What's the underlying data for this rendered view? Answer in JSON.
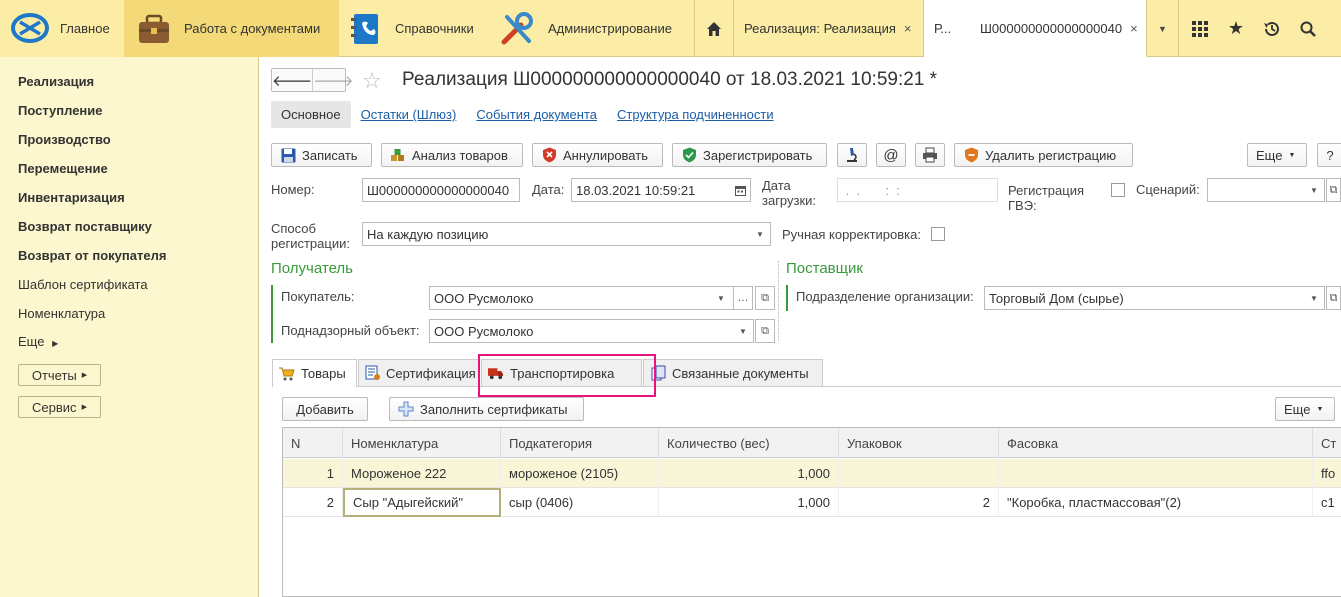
{
  "topbar": {
    "sections": [
      {
        "label": "Главное"
      },
      {
        "label": "Работа с документами"
      },
      {
        "label": "Справочники"
      },
      {
        "label": "Администрирование"
      }
    ],
    "open_tabs": [
      {
        "label": "Реализация: Реализация",
        "close": "×"
      },
      {
        "label_short": "Р...",
        "label": "Ш000000000000000040",
        "close": "×"
      }
    ]
  },
  "sidebar": {
    "items": [
      {
        "label": "Реализация"
      },
      {
        "label": "Поступление"
      },
      {
        "label": "Производство"
      },
      {
        "label": "Перемещение"
      },
      {
        "label": "Инвентаризация"
      },
      {
        "label": "Возврат поставщику"
      },
      {
        "label": "Возврат от покупателя"
      },
      {
        "label": "Шаблон сертификата"
      },
      {
        "label": "Номенклатура"
      }
    ],
    "more_label": "Еще",
    "reports_label": "Отчеты",
    "service_label": "Сервис"
  },
  "document": {
    "title": "Реализация Ш000000000000000040 от 18.03.2021 10:59:21 *",
    "section_tabs": [
      "Основное",
      "Остатки (Шлюз)",
      "События документа",
      "Структура подчиненности"
    ],
    "buttons": {
      "save": "Записать",
      "analyze": "Анализ товаров",
      "cancel": "Аннулировать",
      "register": "Зарегистрировать",
      "email": "@",
      "delete_reg": "Удалить регистрацию",
      "more": "Еще",
      "help": "?"
    },
    "fields": {
      "number_label": "Номер:",
      "number_value": "Ш000000000000000040",
      "date_label": "Дата:",
      "date_value": "18.03.2021 10:59:21",
      "load_date_label_1": "Дата",
      "load_date_label_2": "загрузки:",
      "load_date_value": " .  .       :  :",
      "gve_label_1": "Регистрация",
      "gve_label_2": "ГВЭ:",
      "scenario_label": "Сценарий:",
      "scenario_value": "",
      "reg_method_label_1": "Способ",
      "reg_method_label_2": "регистрации:",
      "reg_method_value": "На каждую позицию",
      "manual_corr_label": "Ручная корректировка:"
    },
    "recipient": {
      "title": "Получатель",
      "buyer_label": "Покупатель:",
      "buyer_value": "ООО Русмолоко",
      "object_label": "Поднадзорный объект:",
      "object_value": "ООО Русмолоко"
    },
    "supplier": {
      "title": "Поставщик",
      "dept_label": "Подразделение организации:",
      "dept_value": "Торговый Дом (сырье)"
    },
    "page_tabs": [
      "Товары",
      "Сертификация",
      "Транспортировка",
      "Связанные документы"
    ],
    "goods": {
      "add_label": "Добавить",
      "fill_cert_label": "Заполнить сертификаты",
      "more_label": "Еще",
      "columns": [
        "N",
        "Номенклатура",
        "Подкатегория",
        "Количество (вес)",
        "Упаковок",
        "Фасовка",
        "Ст"
      ],
      "rows": [
        {
          "n": "1",
          "nom": "Мороженое 222",
          "sub": "мороженое (2105)",
          "qty": "1,000",
          "packs": "",
          "pack": "",
          "extra": "ffo"
        },
        {
          "n": "2",
          "nom": "Сыр \"Адыгейский\"",
          "sub": "сыр (0406)",
          "qty": "1,000",
          "packs": "2",
          "pack": "\"Коробка, пластмассовая\"(2)",
          "extra": "c1"
        }
      ]
    }
  }
}
